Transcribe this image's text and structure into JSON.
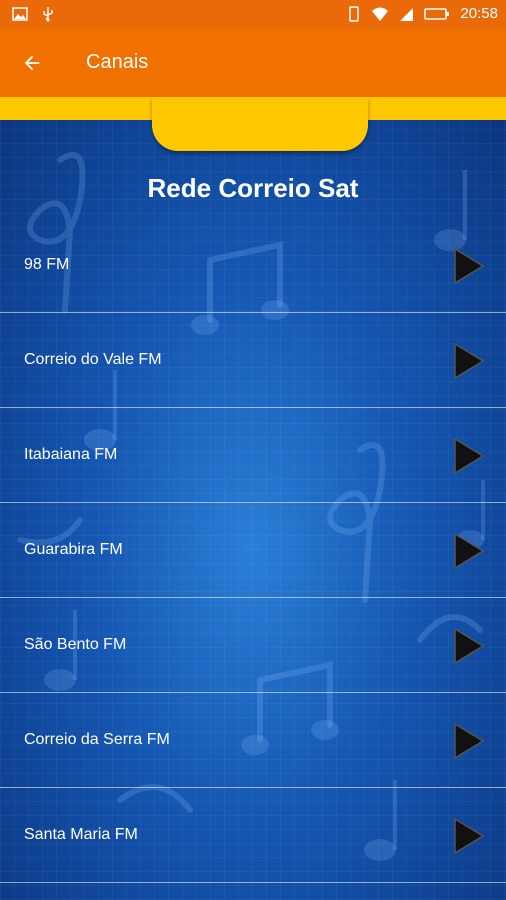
{
  "status_bar": {
    "time": "20:58",
    "battery": "86"
  },
  "app_bar": {
    "title": "Canais"
  },
  "page": {
    "heading": "Rede Correio Sat"
  },
  "channels": [
    {
      "label": "98 FM"
    },
    {
      "label": "Correio do Vale FM"
    },
    {
      "label": "Itabaiana FM"
    },
    {
      "label": "Guarabira FM"
    },
    {
      "label": "São Bento FM"
    },
    {
      "label": "Correio da Serra FM"
    },
    {
      "label": "Santa Maria FM"
    }
  ],
  "colors": {
    "status_bar": "#ea6a0a",
    "app_bar": "#f07000",
    "accent_yellow": "#ffc800",
    "background_blue": "#1557b3"
  },
  "icons": {
    "back": "arrow-left",
    "play": "play-triangle"
  }
}
